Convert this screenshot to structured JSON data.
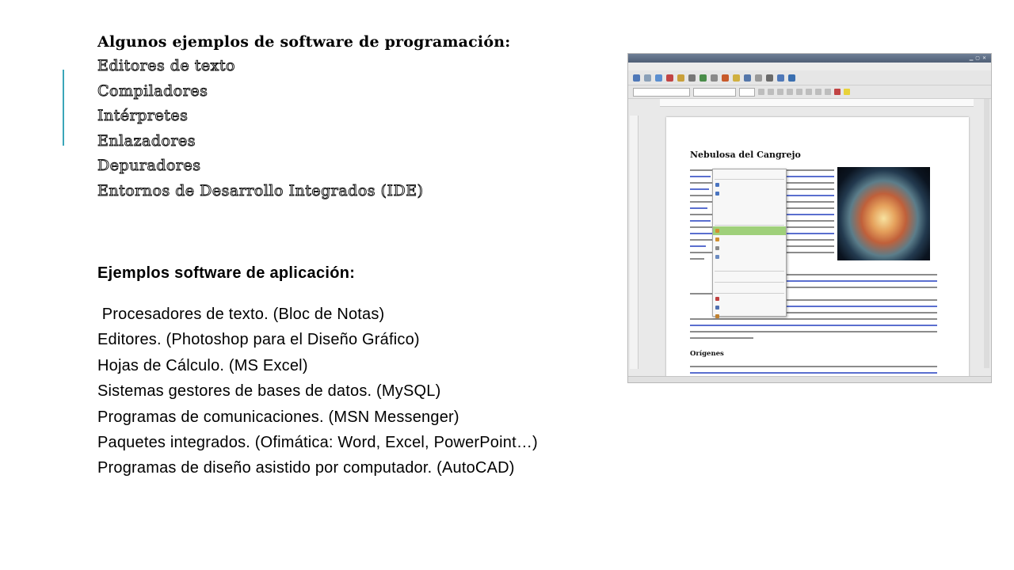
{
  "programming": {
    "title": "Algunos ejemplos de software de programación:",
    "items": [
      "Editores de texto",
      "Compiladores",
      "Intérpretes",
      "Enlazadores",
      "Depuradores",
      "Entornos de Desarrollo Integrados (IDE)"
    ]
  },
  "application": {
    "title": "Ejemplos software de aplicación:",
    "items": [
      " Procesadores de texto. (Bloc de Notas)",
      "Editores. (Photoshop para el Diseño Gráfico)",
      "Hojas de Cálculo. (MS Excel)",
      "Sistemas gestores de bases de datos. (MySQL)",
      "Programas de comunicaciones. (MSN Messenger)",
      "Paquetes integrados. (Ofimática: Word, Excel, PowerPoint…)",
      "Programas de diseño asistido por computador. (AutoCAD)"
    ]
  },
  "screenshot": {
    "doc_heading": "Nebulosa del Cangrejo",
    "doc_subheading": "Orígenes",
    "accent_color": "#3aa6b9",
    "highlight_color": "#9fd07a"
  }
}
